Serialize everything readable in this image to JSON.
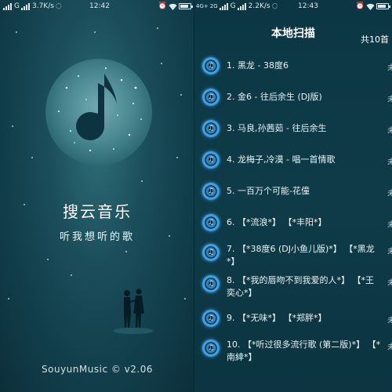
{
  "left_screen": {
    "status": {
      "carrier": "G",
      "speed": "3.7K/s",
      "time": "12:42"
    },
    "app_name": "搜云音乐",
    "slogan": "听我想听的歌",
    "version": "SouyunMusic © v2.06"
  },
  "right_screen": {
    "status": {
      "network": "4G+",
      "network2": "2G",
      "carrier": "G",
      "speed": "2.2K/s",
      "time": "12:43"
    },
    "title": "本地扫描",
    "count": "共10首",
    "disc_glyph": "♫",
    "songs": [
      {
        "title": "1. 黑龙 - 38度6",
        "note": "未"
      },
      {
        "title": "2. 金6 - 往后余生 (DJ版)",
        "note": "未"
      },
      {
        "title": "3. 马良,孙茜茹 - 往后余生",
        "note": "未"
      },
      {
        "title": "4. 龙梅子,冷漠 - 唱一首情歌",
        "note": "未"
      },
      {
        "title": "5. 一百万个可能-花僮",
        "note": "未"
      },
      {
        "title": "6. 【*流浪*】 【*丰阳*】",
        "note": "未"
      },
      {
        "title": "7. 【*38度6 (DJ小鱼儿版)*】 【*黑龙*】",
        "note": "未"
      },
      {
        "title": "8. 【*我的唇吻不到我爱的人*】 【*王奕心*】",
        "note": "未"
      },
      {
        "title": "9. 【*无味*】 【*郑胖*】",
        "note": "未"
      },
      {
        "title": "10. 【*听过很多流行歌 (第二版)*】 【*南緈*】",
        "note": "未"
      }
    ]
  },
  "icons": {
    "logo": "music-note-galaxy-logo",
    "song": "music-disc-icon",
    "wifi": "wifi-icon",
    "battery": "battery-icon"
  }
}
